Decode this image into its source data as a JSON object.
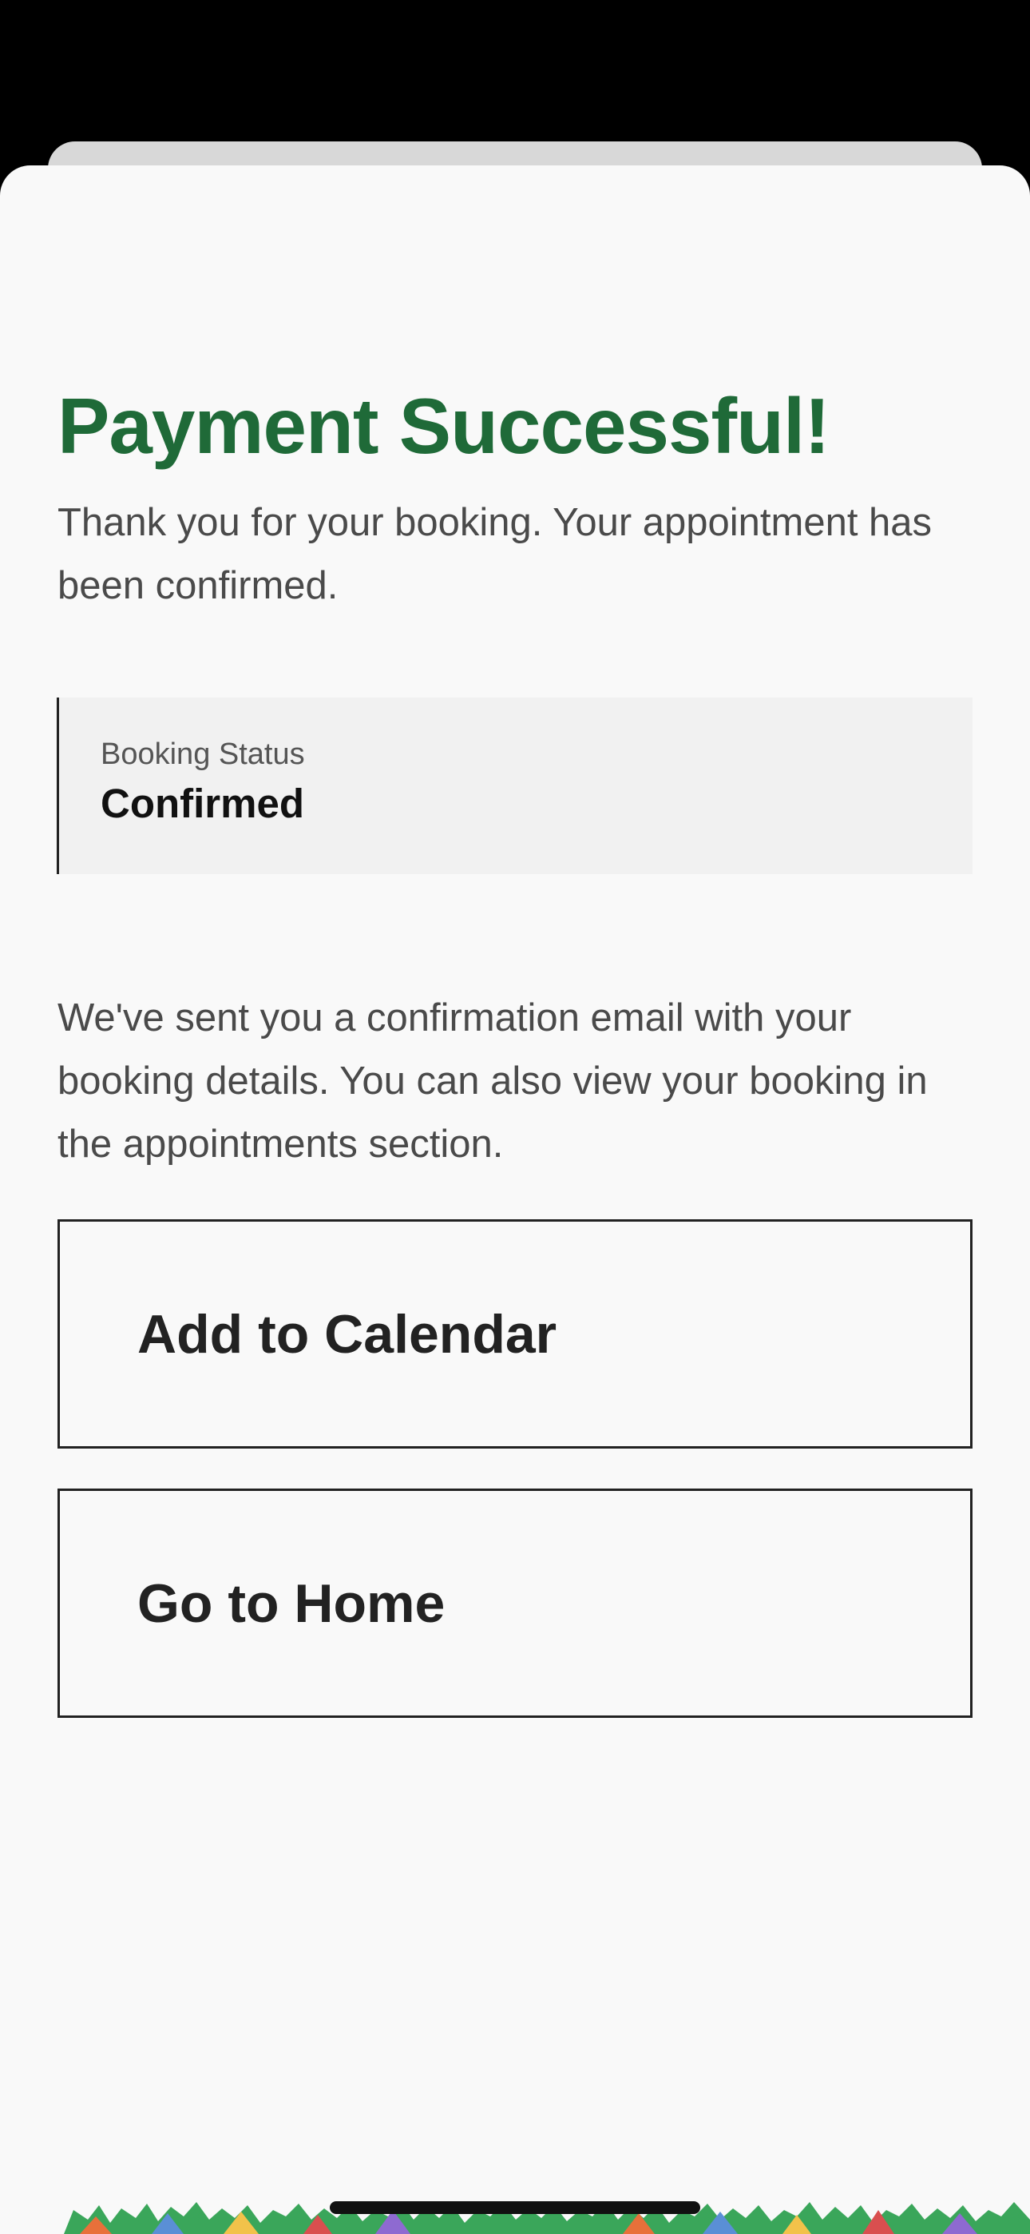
{
  "screen": {
    "title": "Payment Successful!",
    "subtitle": "Thank you for your booking. Your appointment has been confirmed.",
    "status_card": {
      "label": "Booking Status",
      "value": "Confirmed"
    },
    "info": "We've sent you a confirmation email with your booking details. You can also view your booking in the appointments section.",
    "buttons": {
      "add_to_calendar": "Add to Calendar",
      "go_home": "Go to Home"
    }
  },
  "colors": {
    "title": "#1f6a38",
    "text": "#4a4a4a",
    "sheet_background": "#f9f9f9",
    "card_background": "#f1f1f1"
  }
}
